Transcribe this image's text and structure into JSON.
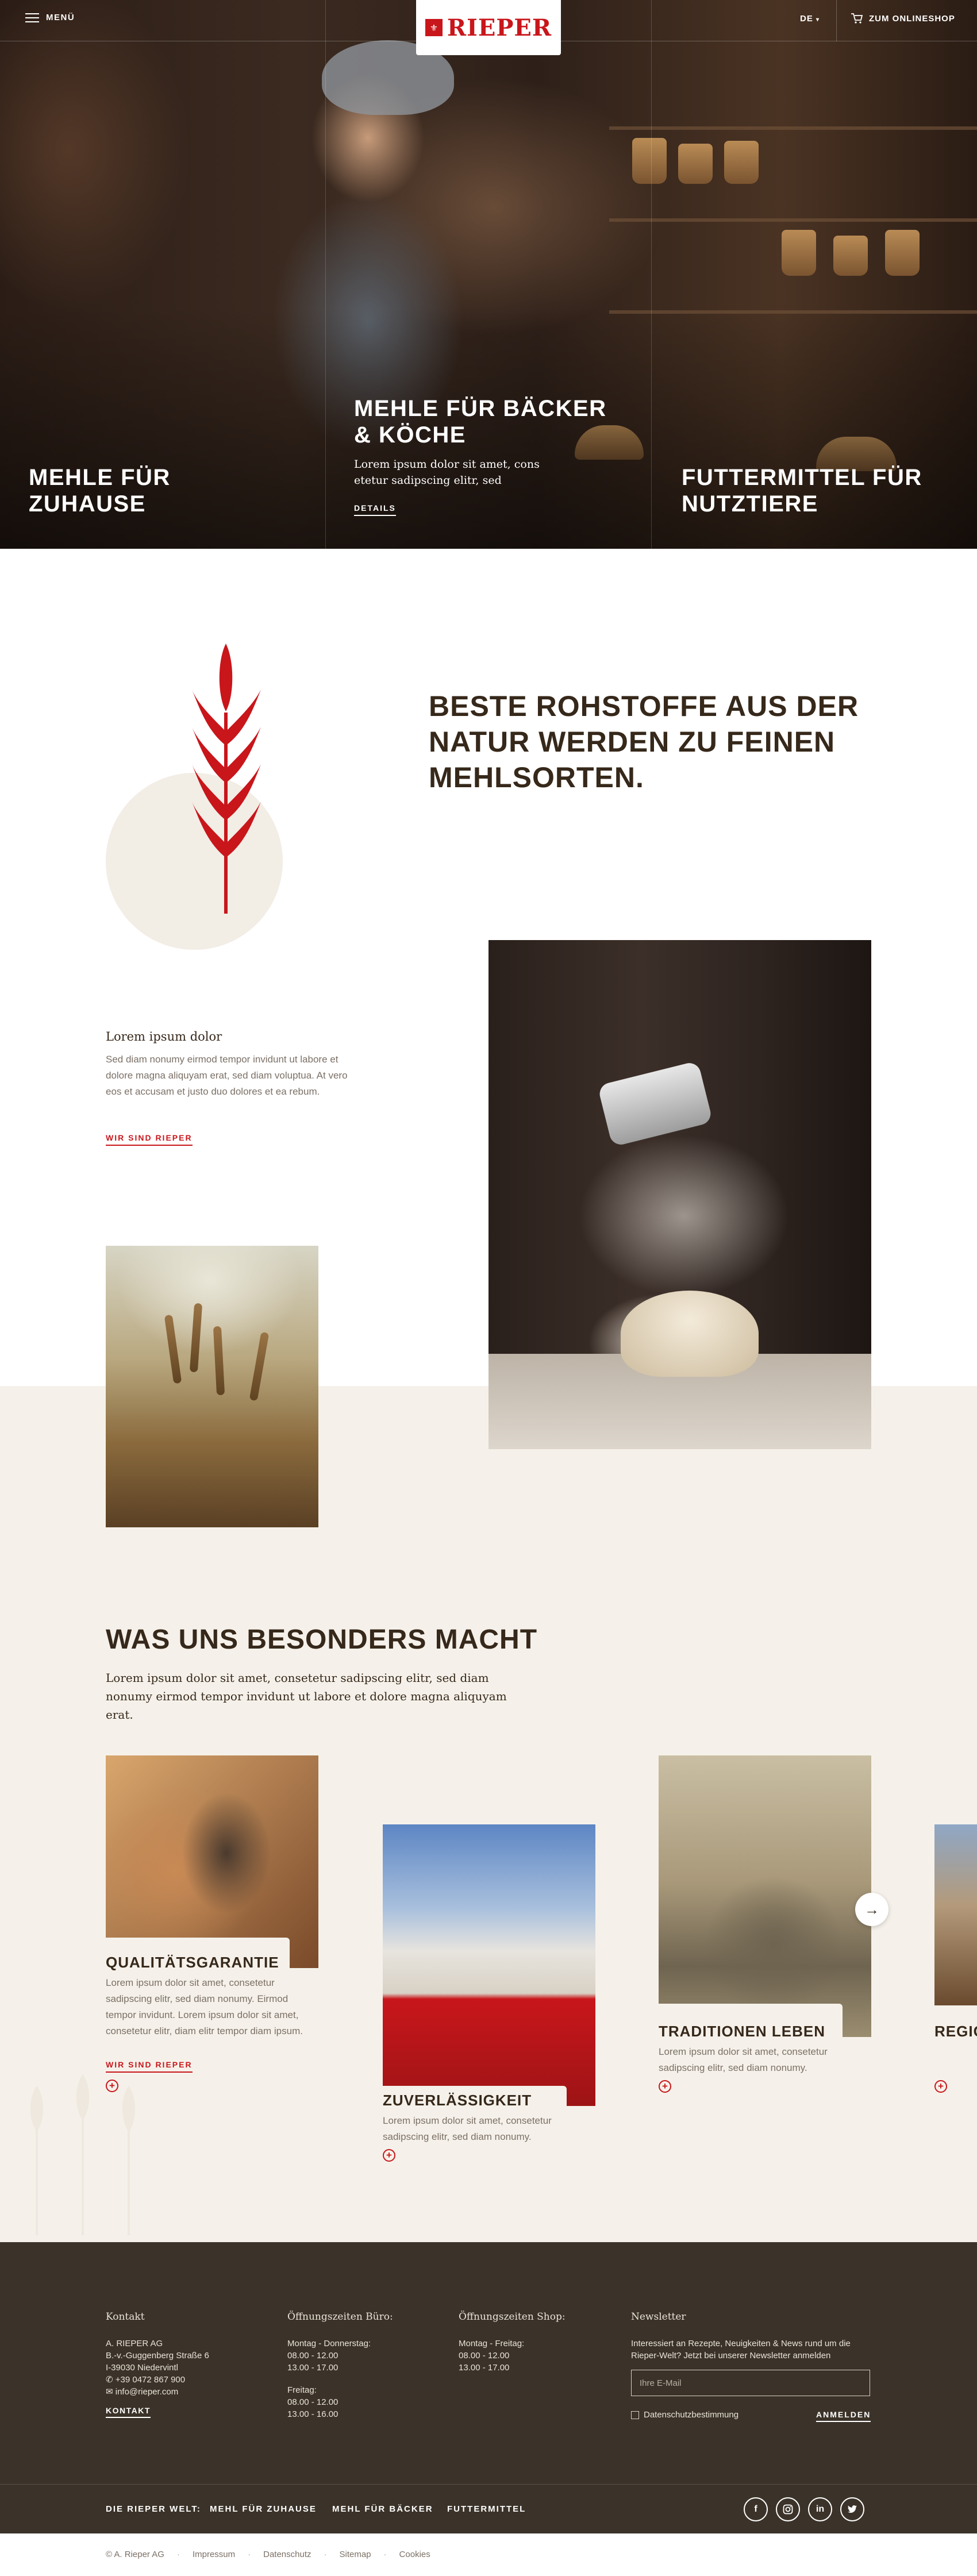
{
  "header": {
    "menu_label": "MENÜ",
    "logo_text": "RIEPER",
    "language": "DE",
    "shop_label": "ZUM ONLINESHOP"
  },
  "hero": {
    "col1_title": "MEHLE FÜR ZUHAUSE",
    "col2_title": "MEHLE FÜR BÄCKER & KÖCHE",
    "col2_text": "Lorem ipsum dolor sit amet, cons etetur sadipscing elitr, sed",
    "col2_link": "DETAILS",
    "col3_title": "FUTTERMITTEL FÜR NUTZTIERE"
  },
  "intro": {
    "heading": "BESTE ROHSTOFFE AUS DER NATUR WERDEN ZU FEINEN MEHLSORTEN.",
    "subtitle": "Lorem ipsum dolor",
    "text": "Sed diam nonumy eirmod tempor invidunt ut labore et dolore magna aliquyam erat, sed diam voluptua. At vero eos et accusam et justo duo dolores et ea rebum.",
    "link": "WIR SIND RIEPER"
  },
  "special": {
    "title": "WAS UNS BESONDERS MACHT",
    "text": "Lorem ipsum dolor sit amet, consetetur sadipscing elitr, sed diam nonumy eirmod tempor invidunt ut labore et dolore magna aliquyam erat.",
    "cards": [
      {
        "title": "QUALITÄTSGARANTIE",
        "text": "Lorem ipsum dolor sit amet, consetetur sadipscing elitr, sed diam nonumy. Eirmod tempor invidunt. Lorem ipsum dolor sit amet, consetetur elitr, diam elitr tempor diam ipsum.",
        "link": "WIR SIND RIEPER"
      },
      {
        "title": "ZUVERLÄSSIGKEIT",
        "text": "Lorem ipsum dolor sit amet, consetetur sadipscing elitr, sed diam nonumy."
      },
      {
        "title": "TRADITIONEN LEBEN",
        "text": "Lorem ipsum dolor sit amet, consetetur sadipscing elitr, sed diam nonumy."
      },
      {
        "title": "REGIO"
      }
    ]
  },
  "footer": {
    "contact_head": "Kontakt",
    "contact_lines": [
      "A. RIEPER AG",
      "B.-v.-Guggenberg Straße 6",
      "I-39030 Niedervintl",
      "+39 0472 867 900",
      "info@rieper.com"
    ],
    "contact_link": "KONTAKT",
    "office_head": "Öffnungszeiten Büro:",
    "office_days1": "Montag - Donnerstag:",
    "office_times1": [
      "08.00 - 12.00",
      "13.00 - 17.00"
    ],
    "office_days2": "Freitag:",
    "office_times2": [
      "08.00 - 12.00",
      "13.00 - 16.00"
    ],
    "shop_head": "Öffnungszeiten Shop:",
    "shop_days": "Montag - Freitag:",
    "shop_times": [
      "08.00 - 12.00",
      "13.00 - 17.00"
    ],
    "newsletter_head": "Newsletter",
    "newsletter_text": "Interessiert an Rezepte, Neuigkeiten & News rund um die Rieper-Welt? Jetzt bei unserer Newsletter anmelden",
    "newsletter_placeholder": "Ihre E-Mail",
    "privacy_label": "Datenschutzbestimmung",
    "submit_label": "ANMELDEN"
  },
  "subfooter": {
    "label": "DIE RIEPER WELT:",
    "links": [
      "MEHL FÜR ZUHAUSE",
      "MEHL FÜR BÄCKER",
      "FUTTERMITTEL"
    ],
    "social": [
      "f",
      "ig",
      "in",
      "tw"
    ]
  },
  "legal": {
    "copyright": "© A. Rieper AG",
    "links": [
      "Impressum",
      "Datenschutz",
      "Sitemap",
      "Cookies"
    ]
  },
  "colors": {
    "brand_red": "#c8161b",
    "dark_brown": "#3b3329",
    "beige": "#f5f1ea"
  }
}
